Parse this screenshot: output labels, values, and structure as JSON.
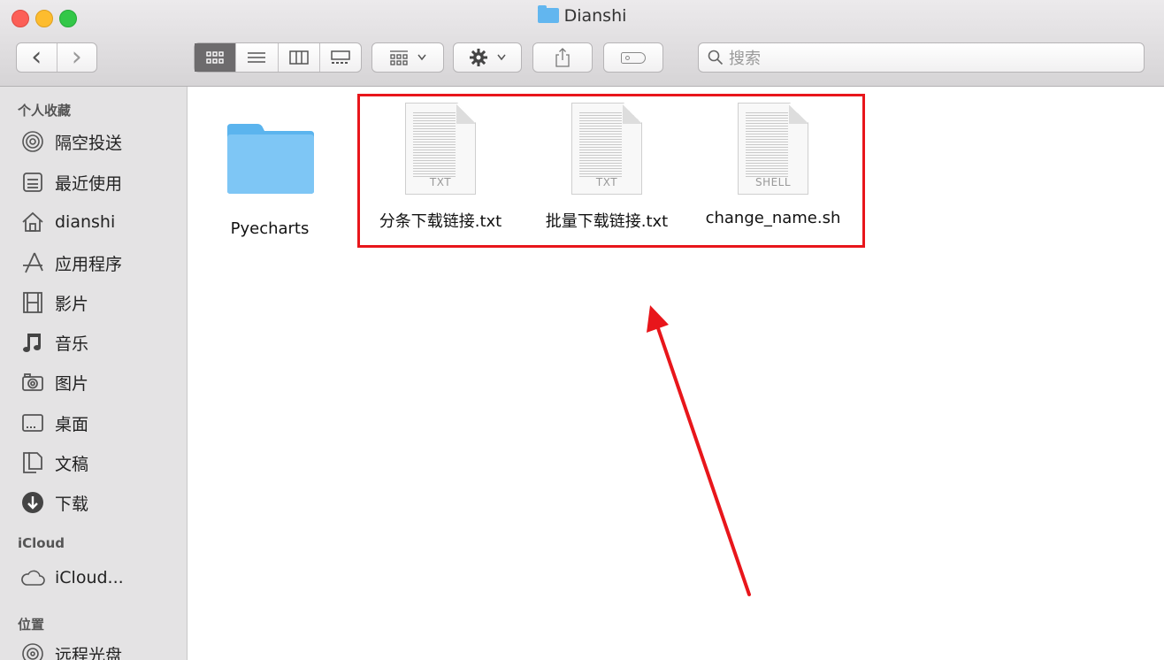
{
  "window": {
    "title": "Dianshi"
  },
  "toolbar": {
    "back_icon": "‹",
    "forward_icon": "›",
    "search_placeholder": "搜索"
  },
  "sidebar": {
    "sections": [
      {
        "heading": "个人收藏"
      },
      {
        "heading": "iCloud"
      },
      {
        "heading": "位置"
      }
    ],
    "favorites": [
      {
        "label": "隔空投送",
        "icon": "airdrop-icon"
      },
      {
        "label": "最近使用",
        "icon": "recents-icon"
      },
      {
        "label": "dianshi",
        "icon": "home-icon"
      },
      {
        "label": "应用程序",
        "icon": "applications-icon"
      },
      {
        "label": "影片",
        "icon": "movies-icon"
      },
      {
        "label": "音乐",
        "icon": "music-icon"
      },
      {
        "label": "图片",
        "icon": "pictures-icon"
      },
      {
        "label": "桌面",
        "icon": "desktop-icon"
      },
      {
        "label": "文稿",
        "icon": "documents-icon"
      },
      {
        "label": "下载",
        "icon": "downloads-icon"
      }
    ],
    "icloud": [
      {
        "label": "iCloud...",
        "icon": "cloud-icon"
      }
    ],
    "locations": [
      {
        "label": "远程光盘",
        "icon": "disc-icon"
      }
    ]
  },
  "files": [
    {
      "name": "Pyecharts",
      "kind": "folder"
    },
    {
      "name": "分条下载链接.txt",
      "kind": "document",
      "type_label": "TXT"
    },
    {
      "name": "批量下载链接.txt",
      "kind": "document",
      "type_label": "TXT"
    },
    {
      "name": "change_name.sh",
      "kind": "document",
      "type_label": "SHELL"
    }
  ],
  "annotation": {
    "highlight_color": "#e8161b",
    "arrow_color": "#e8161b"
  }
}
